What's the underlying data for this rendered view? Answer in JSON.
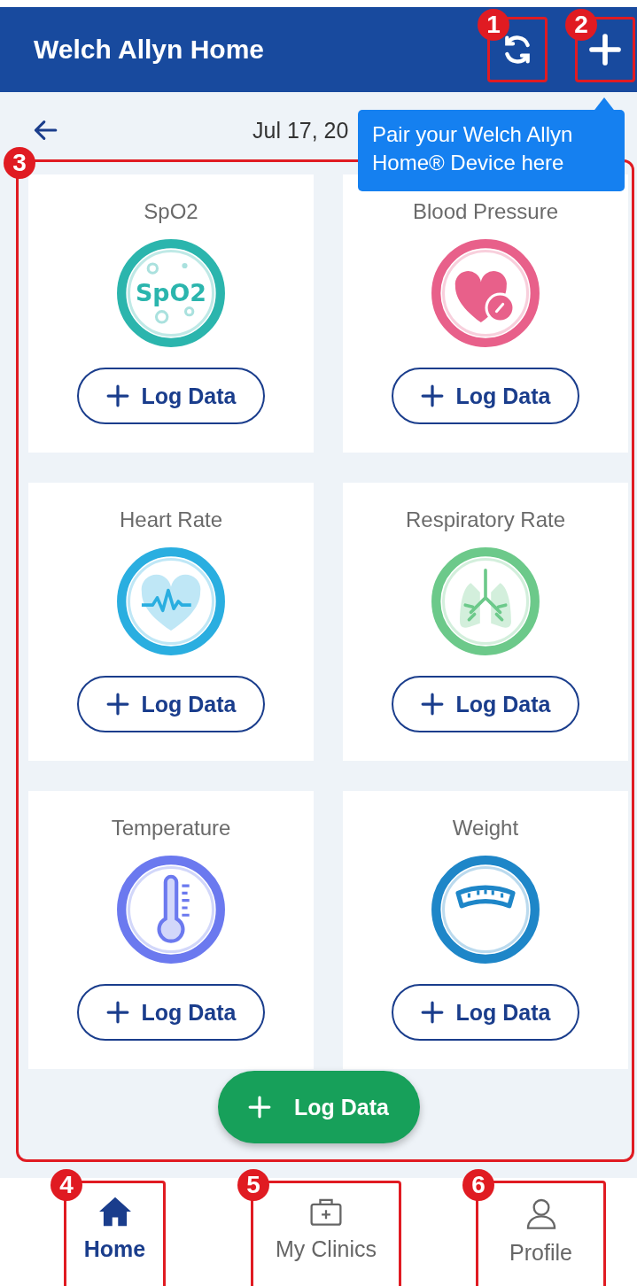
{
  "app_bar": {
    "title": "Welch Allyn Home",
    "actions": [
      {
        "kind": "sync",
        "callout": "1"
      },
      {
        "kind": "add",
        "callout": "2"
      }
    ]
  },
  "date_bar": {
    "date": "Jul 17, 20"
  },
  "tooltip": {
    "text": "Pair your Welch Allyn Home® Device here"
  },
  "metrics": {
    "callout": "3",
    "cards": [
      {
        "title": "SpO2",
        "kind": "spo2",
        "icon_text": "SpO2",
        "color": "#2bb5ad",
        "button": "Log Data"
      },
      {
        "title": "Blood Pressure",
        "kind": "blood_pressure",
        "color": "#e8608a",
        "button": "Log Data"
      },
      {
        "title": "Heart Rate",
        "kind": "heart_rate",
        "color": "#2aaee0",
        "button": "Log Data"
      },
      {
        "title": "Respiratory Rate",
        "kind": "respiratory",
        "color": "#6cc98a",
        "button": "Log Data"
      },
      {
        "title": "Temperature",
        "kind": "temperature",
        "color": "#6b79ef",
        "button": "Log Data"
      },
      {
        "title": "Weight",
        "kind": "weight",
        "color": "#1e86c8",
        "button": "Log Data"
      }
    ]
  },
  "fab": {
    "label": "Log Data"
  },
  "nav": [
    {
      "label": "Home",
      "kind": "home",
      "selected": true,
      "callout": "4"
    },
    {
      "label": "My Clinics",
      "kind": "clinic",
      "selected": false,
      "callout": "5"
    },
    {
      "label": "Profile",
      "kind": "profile",
      "selected": false,
      "callout": "6"
    }
  ]
}
